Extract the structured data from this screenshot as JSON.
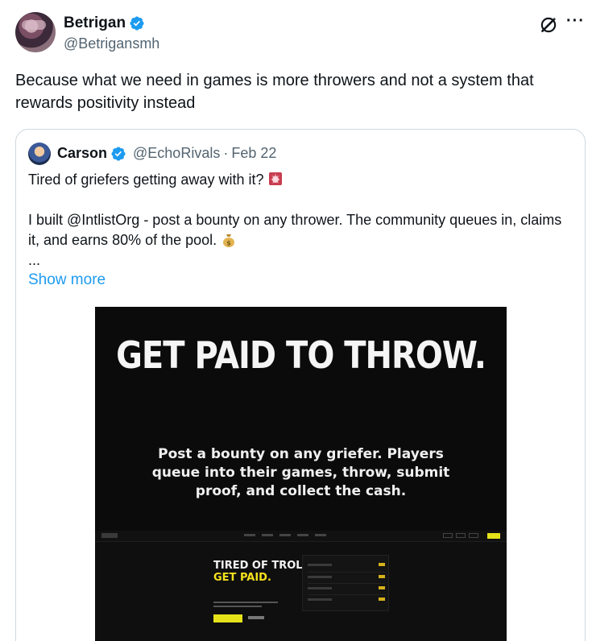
{
  "author": {
    "name": "Betrigan",
    "handle": "@Betrigansmh"
  },
  "post": {
    "text": "Because what we need in games is more throwers and not a system that rewards positivity instead"
  },
  "icons": {
    "verified": "verified-badge-icon",
    "grok": "grok-icon",
    "more": "more-options-icon"
  },
  "more_label": "···",
  "quoted": {
    "name": "Carson",
    "handle": "@EchoRivals",
    "separator": "·",
    "date": "Feb 22",
    "line1": "Tired of griefers getting away with it?",
    "line2": "I built @IntlistOrg - post a bounty on any thrower. The community queues in, claims it, and earns 80% of the pool.",
    "line3": "...",
    "show_more": "Show more",
    "media": {
      "headline": "GET PAID TO THROW.",
      "subtext": "Post a bounty on any griefer. Players queue into their games, throw, submit proof, and collect the cash.",
      "site_title_white": "TIRED OF TROLLS?",
      "site_title_yellow": "GET PAID."
    }
  },
  "colors": {
    "link": "#1d9bf0",
    "verified": "#1d9bf0",
    "muted": "#536471",
    "accent_yellow": "#e6e21a"
  }
}
